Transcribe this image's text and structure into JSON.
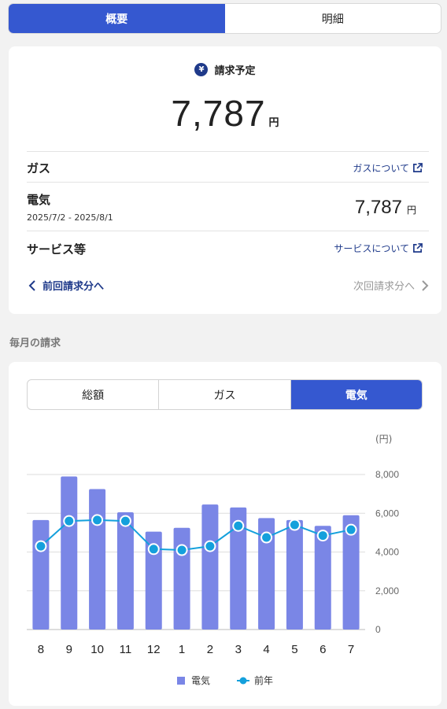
{
  "top_tabs": [
    {
      "label": "概要",
      "active": true
    },
    {
      "label": "明細",
      "active": false
    }
  ],
  "summary": {
    "title": "請求予定",
    "icon": "yen-icon",
    "amount": "7,787",
    "amount_unit": "円",
    "rows": {
      "gas": {
        "label": "ガス",
        "link": "ガスについて"
      },
      "electric": {
        "label": "電気",
        "period": "2025/7/2 - 2025/8/1",
        "value": "7,787",
        "unit": "円"
      },
      "service": {
        "label": "サービス等",
        "link": "サービスについて"
      }
    },
    "prev_label": "前回請求分へ",
    "next_label": "次回請求分へ"
  },
  "monthly": {
    "section_title": "毎月の請求",
    "segments": [
      {
        "label": "総額",
        "active": false
      },
      {
        "label": "ガス",
        "active": false
      },
      {
        "label": "電気",
        "active": true
      }
    ]
  },
  "chart_data": {
    "type": "bar",
    "unit_label": "(円)",
    "categories": [
      "8",
      "9",
      "10",
      "11",
      "12",
      "1",
      "2",
      "3",
      "4",
      "5",
      "6",
      "7"
    ],
    "yticks": [
      "0",
      "2,000",
      "4,000",
      "6,000",
      "8,000"
    ],
    "ylim": [
      0,
      8000
    ],
    "grid": true,
    "legend_placement": "bottom",
    "series": [
      {
        "name": "電気",
        "type": "bar",
        "color": "#7a86e6",
        "values": [
          5650,
          7900,
          7250,
          6050,
          5050,
          5250,
          6450,
          6300,
          5750,
          5650,
          5350,
          5900
        ]
      },
      {
        "name": "前年",
        "type": "line",
        "color": "#14a0dc",
        "values": [
          4300,
          5600,
          5650,
          5600,
          4150,
          4100,
          4300,
          5350,
          4750,
          5400,
          4850,
          5150
        ]
      }
    ]
  }
}
